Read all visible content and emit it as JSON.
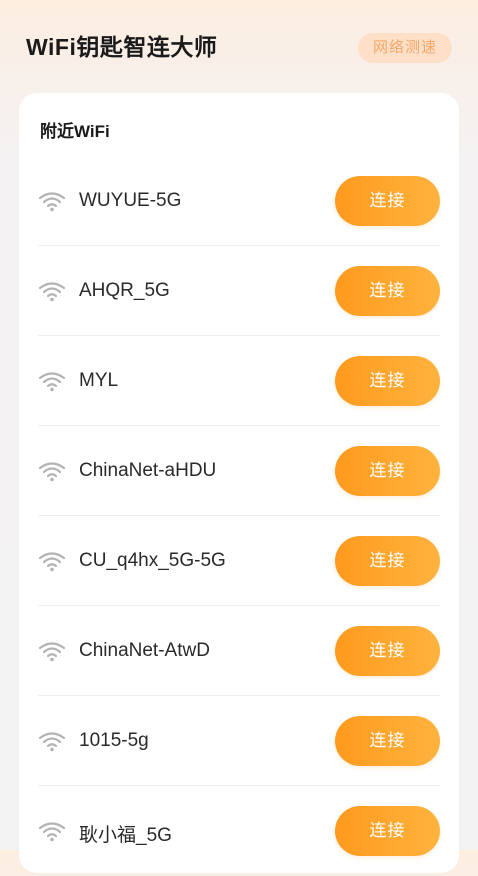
{
  "header": {
    "title": "WiFi钥匙智连大师",
    "speed_test_label": "网络测速"
  },
  "nearby": {
    "section_title": "附近WiFi",
    "networks": [
      {
        "ssid": "WUYUE-5G",
        "action": "连接"
      },
      {
        "ssid": "AHQR_5G",
        "action": "连接"
      },
      {
        "ssid": "MYL",
        "action": "连接"
      },
      {
        "ssid": "ChinaNet-aHDU",
        "action": "连接"
      },
      {
        "ssid": "CU_q4hx_5G-5G",
        "action": "连接"
      },
      {
        "ssid": "ChinaNet-AtwD",
        "action": "连接"
      },
      {
        "ssid": "1015-5g",
        "action": "连接"
      },
      {
        "ssid": "耿小福_5G",
        "action": "连接"
      }
    ]
  },
  "icons": {
    "wifi": "wifi-icon"
  },
  "colors": {
    "accent_start": "#ff9a1e",
    "accent_end": "#ffb33e",
    "speed_test_bg": "#fde0c7",
    "speed_test_text": "#f6a76a",
    "wifi_icon": "#b3b3b3"
  }
}
